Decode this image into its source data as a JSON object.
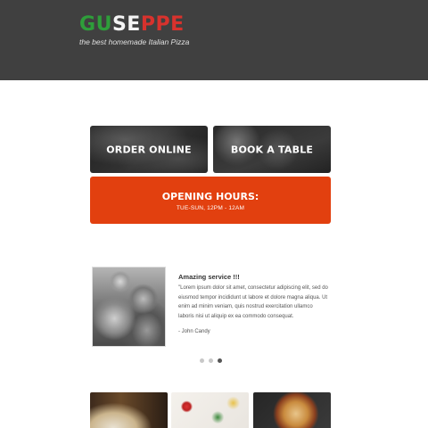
{
  "header": {
    "logo_letters": [
      {
        "char": "G",
        "color": "#2e9e3a"
      },
      {
        "char": "U",
        "color": "#2e9e3a"
      },
      {
        "char": "S",
        "color": "#f4f4f4"
      },
      {
        "char": "E",
        "color": "#f4f4f4"
      },
      {
        "char": "P",
        "color": "#d8322d"
      },
      {
        "char": "P",
        "color": "#d8322d"
      },
      {
        "char": "E",
        "color": "#d8322d"
      }
    ],
    "tagline": "the best homemade Italian Pizza"
  },
  "tiles": {
    "order_label": "ORDER ONLINE",
    "book_label": "BOOK A TABLE"
  },
  "hours": {
    "title": "OPENING HOURS:",
    "subtitle": "TUE-SUN, 12PM - 12AM",
    "color": "#e2400f"
  },
  "review": {
    "title": "Amazing service !!!",
    "body": "\"Lorem ipsum dolor sit amet, consectetur adipiscing elit, sed do eiusmod tempor incididunt ut labore et dolore magna aliqua. Ut enim ad minim veniam, quis nostrud exercitation ullamco laboris nisi ut aliquip ex ea commodo consequat.",
    "author": "- John Candy"
  },
  "carousel": {
    "total": 3,
    "active": 3
  },
  "gallery": [
    "restaurant-photo",
    "ingredients-photo",
    "pizza-photo"
  ]
}
